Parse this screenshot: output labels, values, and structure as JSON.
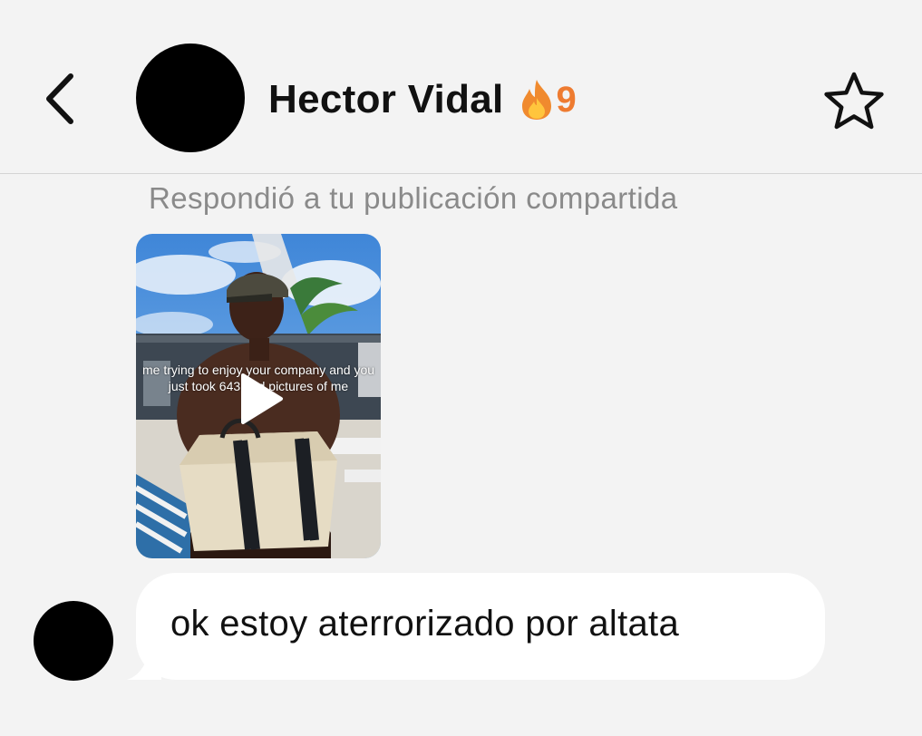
{
  "header": {
    "contact_name": "Hector Vidal",
    "streak_count": "9",
    "icons": {
      "back": "chevron-left-icon",
      "streak": "flame-icon",
      "favorite": "star-icon"
    },
    "colors": {
      "streak": "#ee7b30"
    }
  },
  "thread": {
    "reply_label": "Respondió a tu publicación compartida",
    "shared_post": {
      "caption": "me trying to enjoy your company and you just took 643 bad pictures of me",
      "icon": "play-icon"
    },
    "message": {
      "text": "ok estoy aterrorizado por altata"
    }
  }
}
